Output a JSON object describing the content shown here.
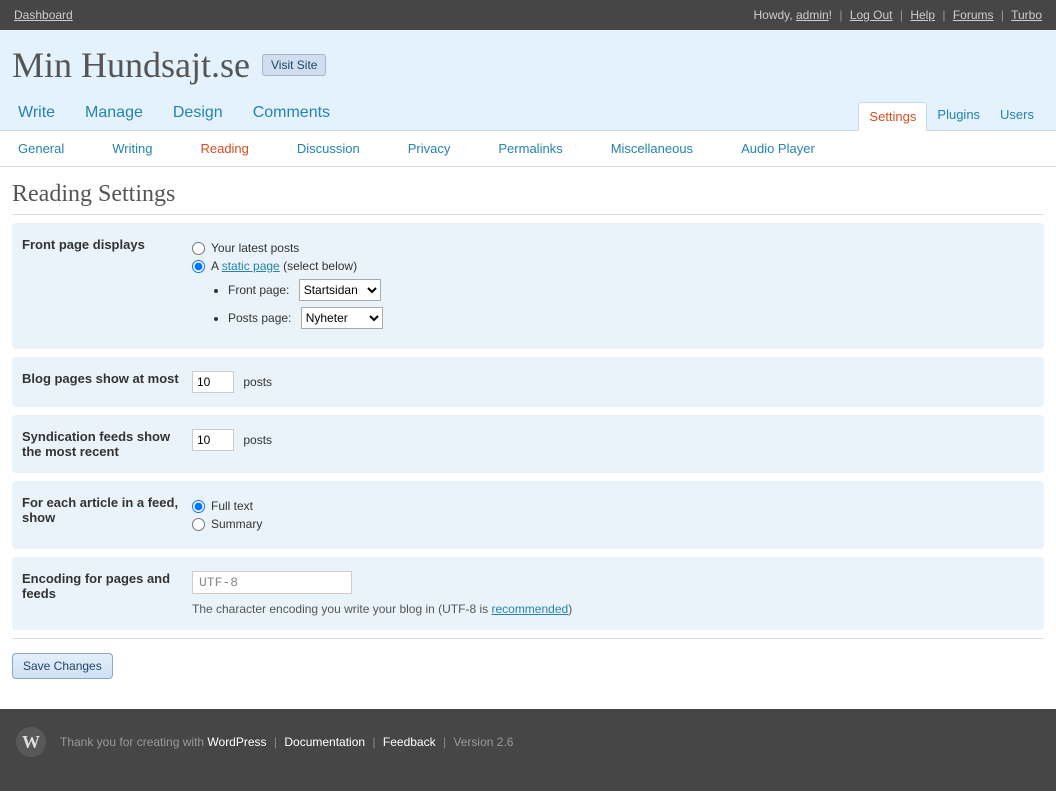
{
  "topbar": {
    "dashboard": "Dashboard",
    "howdy_prefix": "Howdy, ",
    "admin_user": "admin",
    "howdy_suffix": "!",
    "logout": "Log Out",
    "help": "Help",
    "forums": "Forums",
    "turbo": "Turbo"
  },
  "header": {
    "site_title": "Min Hundsajt.se",
    "visit_site": "Visit Site"
  },
  "main_nav": {
    "left": [
      "Write",
      "Manage",
      "Design",
      "Comments"
    ],
    "right": [
      "Settings",
      "Plugins",
      "Users"
    ],
    "right_current_index": 0
  },
  "sub_nav": {
    "items": [
      "General",
      "Writing",
      "Reading",
      "Discussion",
      "Privacy",
      "Permalinks",
      "Miscellaneous",
      "Audio Player"
    ],
    "current_index": 2
  },
  "page": {
    "title": "Reading Settings",
    "front_page": {
      "label": "Front page displays",
      "opt_latest": "Your latest posts",
      "opt_static_prefix": "A ",
      "opt_static_link": "static page",
      "opt_static_suffix": " (select below)",
      "selected": "static",
      "front_page_label": "Front page:",
      "front_page_value": "Startsidan",
      "posts_page_label": "Posts page:",
      "posts_page_value": "Nyheter"
    },
    "blog_pages": {
      "label": "Blog pages show at most",
      "value": "10",
      "suffix": "posts"
    },
    "syndication": {
      "label": "Syndication feeds show the most recent",
      "value": "10",
      "suffix": "posts"
    },
    "feed_article": {
      "label": "For each article in a feed, show",
      "opt_full": "Full text",
      "opt_summary": "Summary",
      "selected": "full"
    },
    "encoding": {
      "label": "Encoding for pages and feeds",
      "value": "UTF-8",
      "desc_prefix": "The character encoding you write your blog in (UTF-8 is ",
      "desc_link": "recommended",
      "desc_suffix": ")"
    },
    "save_button": "Save Changes"
  },
  "footer": {
    "thank_prefix": "Thank you for creating with ",
    "wordpress": "WordPress",
    "documentation": "Documentation",
    "feedback": "Feedback",
    "version": "Version 2.6"
  }
}
